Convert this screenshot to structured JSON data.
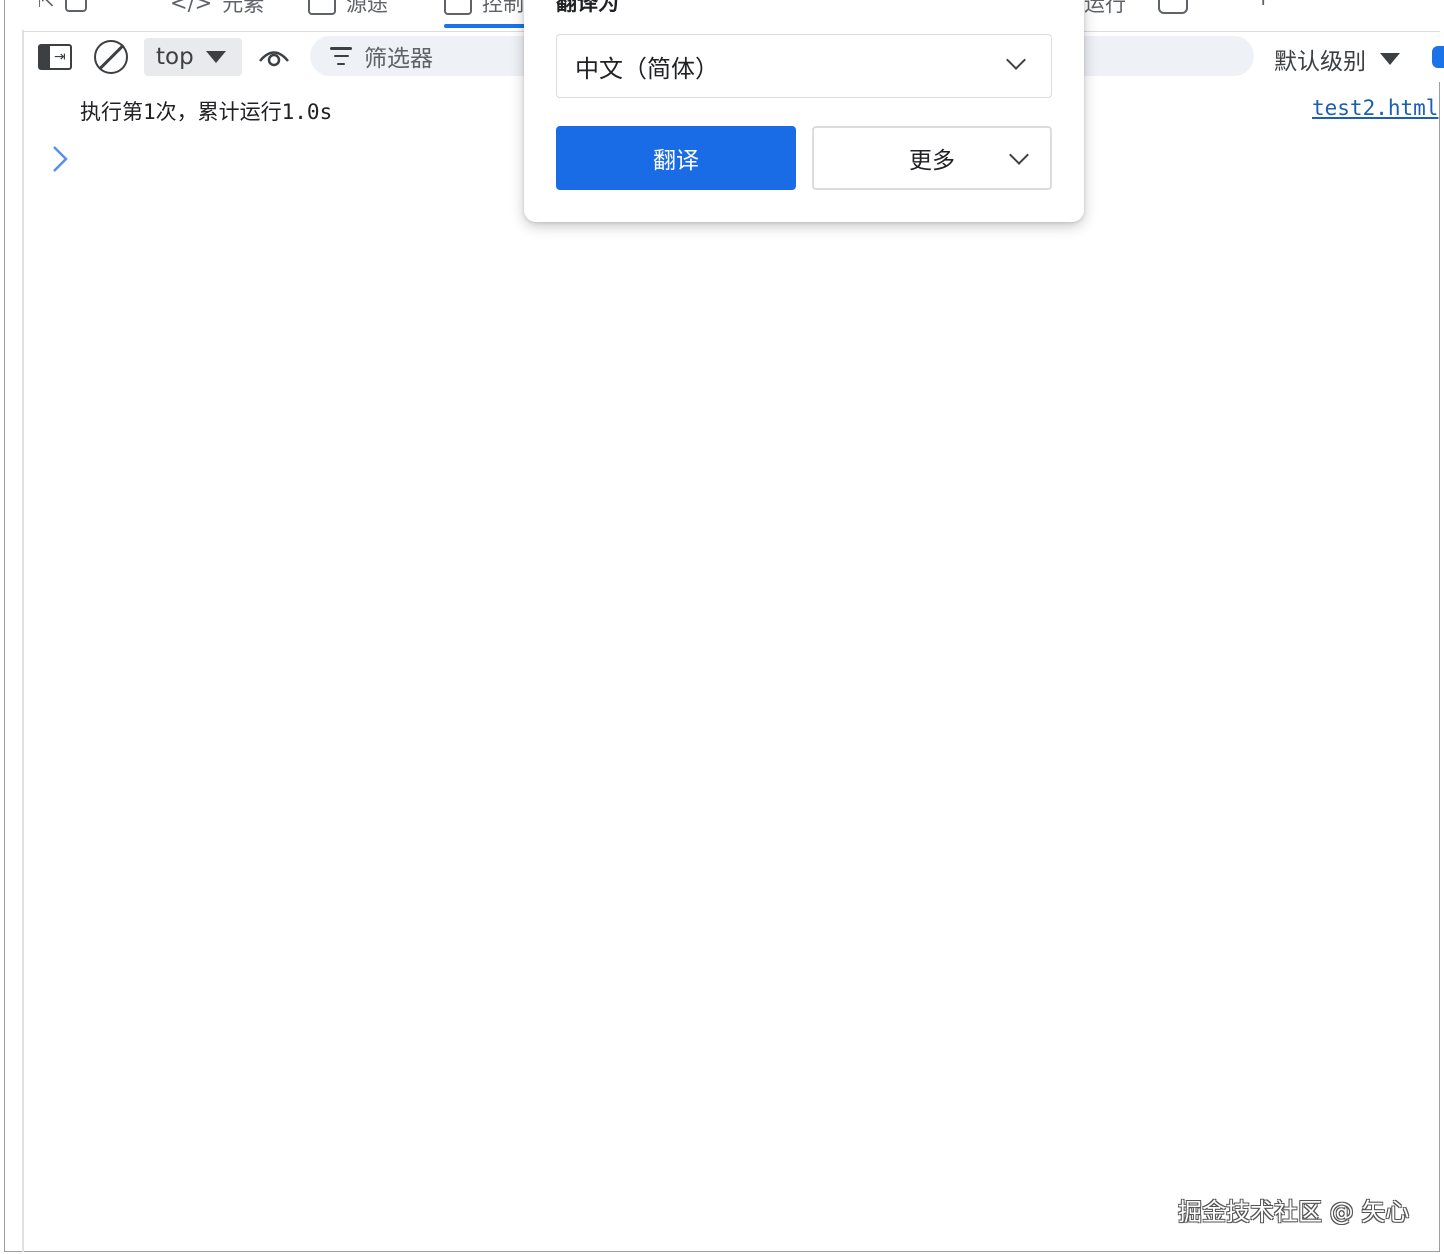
{
  "devtools_tabs": [
    {
      "label": "元素"
    },
    {
      "label": "源途"
    },
    {
      "label": "控制台"
    },
    {
      "label": "运行"
    }
  ],
  "toolbar": {
    "context": "top",
    "filter_placeholder": "筛选器",
    "log_level": "默认级别"
  },
  "console": {
    "message": "执行第1次，累计运行1.0s",
    "source": "test2.html"
  },
  "translate_popup": {
    "title": "翻译为",
    "target_language": "中文（简体）",
    "translate_label": "翻译",
    "more_label": "更多"
  },
  "watermark": "掘金技术社区 @ 矢心",
  "colors": {
    "accent": "#1a6be6",
    "link": "#1a5fb4",
    "filter_bg": "#eef1f6"
  }
}
